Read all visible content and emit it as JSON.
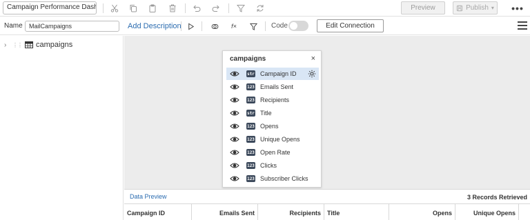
{
  "toolbar": {
    "title": "Campaign Performance Dashboard",
    "icons": [
      "scissors-icon",
      "copy-icon",
      "paste-icon",
      "delete-icon",
      "undo-icon",
      "redo-icon",
      "filter-icon",
      "refresh-icon"
    ],
    "preview_label": "Preview",
    "publish_label": "Publish",
    "more_label": "•••"
  },
  "query_bar": {
    "name_label": "Name",
    "name_value": "MailCampaigns",
    "add_description": "Add Description",
    "fx_label": "f×",
    "code_label": "Code",
    "code_enabled": false,
    "edit_connection": "Edit Connection"
  },
  "tree": {
    "items": [
      {
        "label": "campaigns"
      }
    ]
  },
  "card": {
    "title": "campaigns",
    "close": "×",
    "fields": [
      {
        "type": "str",
        "name": "Campaign ID",
        "selected": true
      },
      {
        "type": "123",
        "name": "Emails Sent"
      },
      {
        "type": "123",
        "name": "Recipients"
      },
      {
        "type": "str",
        "name": "Title"
      },
      {
        "type": "123",
        "name": "Opens"
      },
      {
        "type": "123",
        "name": "Unique Opens"
      },
      {
        "type": "123",
        "name": "Open Rate"
      },
      {
        "type": "123",
        "name": "Clicks"
      },
      {
        "type": "123",
        "name": "Subscriber Clicks"
      }
    ]
  },
  "data_preview": {
    "label": "Data Preview",
    "records": "3 Records Retrieved",
    "columns": [
      {
        "name": "Campaign ID",
        "align": "left"
      },
      {
        "name": "Emails Sent",
        "align": "right"
      },
      {
        "name": "Recipients",
        "align": "right"
      },
      {
        "name": "Title",
        "align": "left"
      },
      {
        "name": "Opens",
        "align": "right"
      },
      {
        "name": "Unique Opens",
        "align": "right"
      }
    ]
  },
  "colors": {
    "accent": "#2b6cb0",
    "badge": "#3d4a5c",
    "selected_row": "#d9e6f5",
    "canvas": "#ececec"
  }
}
